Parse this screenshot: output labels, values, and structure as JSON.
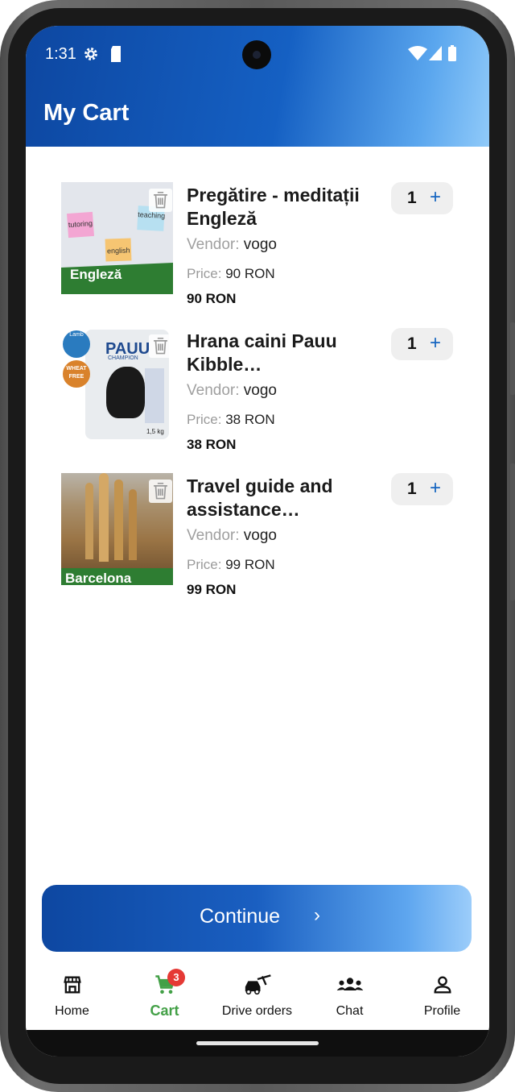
{
  "status": {
    "time": "1:31"
  },
  "header": {
    "title": "My Cart"
  },
  "labels": {
    "vendor": "Vendor:",
    "price": "Price:"
  },
  "items": [
    {
      "title": "Pregătire - meditații Engleză",
      "vendor": "vogo",
      "price": "90 RON",
      "total": "90 RON",
      "quantity": "1",
      "plus": "+",
      "image": {
        "tag": "Engleză",
        "notes": [
          "tutoring",
          "teaching",
          "english"
        ]
      }
    },
    {
      "title": "Hrana caini Pauu Kibble monoproteic",
      "vendor": "vogo",
      "price": "38 RON",
      "total": "38 RON",
      "quantity": "1",
      "plus": "+",
      "image": {
        "brand": "PAUU",
        "sub": "CHAMPION",
        "badge1": "Lamb",
        "badge2": "WHEAT FREE",
        "weight": "1,5 kg"
      }
    },
    {
      "title": "Travel guide and assistance Barcelona",
      "vendor": "vogo",
      "price": "99 RON",
      "total": "99 RON",
      "quantity": "1",
      "plus": "+",
      "image": {
        "tag": "Barcelona"
      }
    }
  ],
  "continue": {
    "label": "Continue",
    "arrow": "›"
  },
  "nav": {
    "cart_badge": "3",
    "items": [
      {
        "label": "Home",
        "icon": "store-icon"
      },
      {
        "label": "Cart",
        "icon": "cart-icon",
        "active": true
      },
      {
        "label": "Drive orders",
        "icon": "car-icon"
      },
      {
        "label": "Chat",
        "icon": "people-icon"
      },
      {
        "label": "Profile",
        "icon": "person-icon"
      }
    ]
  },
  "colors": {
    "brand_dark": "#0d47a1",
    "brand_light": "#90caf9",
    "active_nav": "#43a047",
    "badge": "#e53935"
  }
}
